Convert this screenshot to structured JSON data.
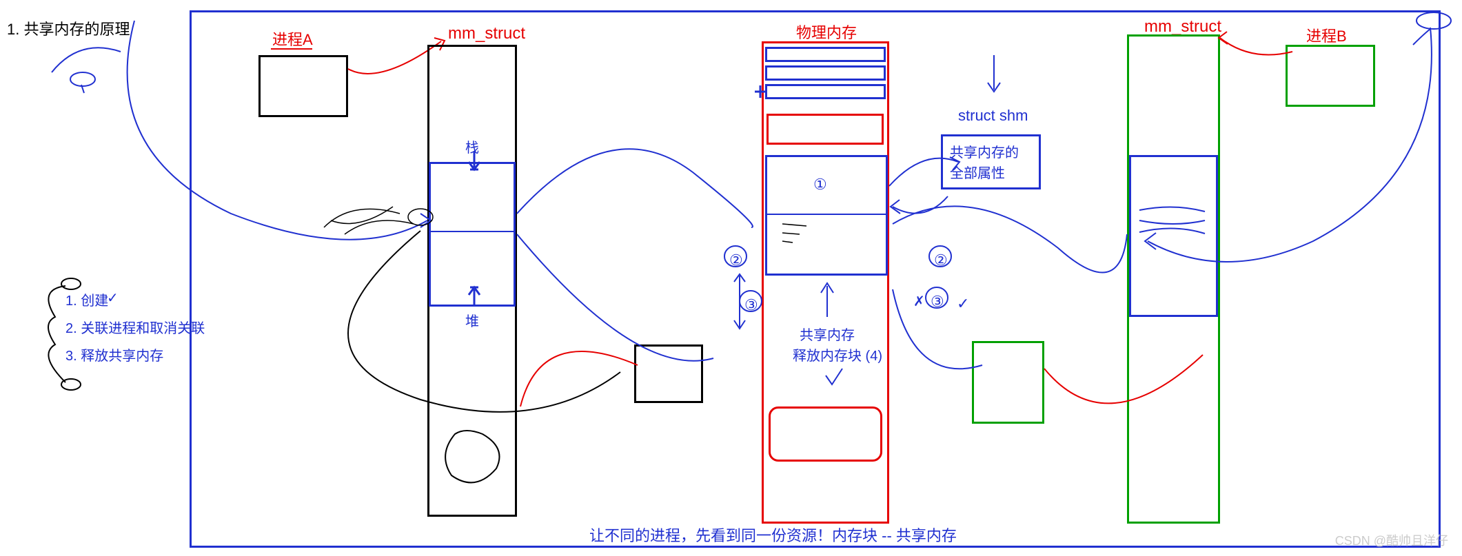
{
  "title": "1. 共享内存的原理",
  "steps": {
    "s1": "1. 创建",
    "s2": "2. 关联进程和取消关联",
    "s3": "3. 释放共享内存"
  },
  "proc_a": "进程A",
  "proc_b": "进程B",
  "mm_struct_left": "mm_struct",
  "mm_struct_right": "mm_struct",
  "stack": "栈",
  "heap": "堆",
  "phys_mem": "物理内存",
  "struct_shm": "struct shm",
  "shm_attr_line1": "共享内存的",
  "shm_attr_line2": "全部属性",
  "shm_label": "共享内存",
  "release_block": "释放内存块 (4)",
  "marks": {
    "m1": "①",
    "m2": "②",
    "m2b": "②",
    "m3": "③",
    "m3b": "③"
  },
  "check": "✓",
  "cross": "✗",
  "bottom_caption": "让不同的进程，先看到同一份资源！内存块 -- 共享内存",
  "watermark": "CSDN @酷帅且洋仔",
  "arrow_down": "↓",
  "arrow_up": "↑"
}
